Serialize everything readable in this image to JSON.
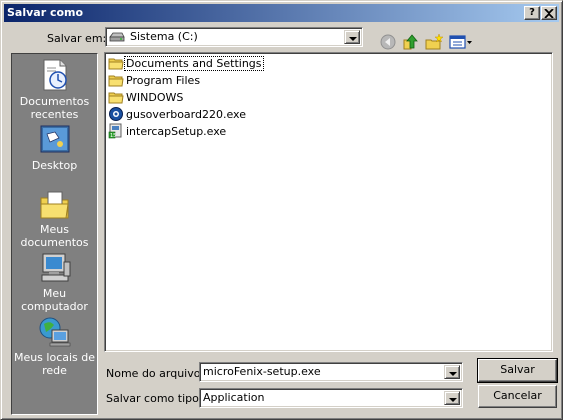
{
  "window": {
    "title": "Salvar como",
    "help_button": "?",
    "close_button": "✕"
  },
  "toolbar": {
    "save_in_label": "Salvar em:",
    "location": "Sistema (C:)",
    "buttons": [
      "back-icon",
      "up-folder-icon",
      "new-folder-icon",
      "views-menu-icon"
    ]
  },
  "places": [
    {
      "label": "Documentos recentes",
      "icon": "recent-documents-icon"
    },
    {
      "label": "Desktop",
      "icon": "desktop-icon"
    },
    {
      "label": "Meus documentos",
      "icon": "my-documents-icon"
    },
    {
      "label": "Meu computador",
      "icon": "my-computer-icon"
    },
    {
      "label": "Meus locais de rede",
      "icon": "network-places-icon"
    }
  ],
  "files": [
    {
      "name": "Documents and Settings",
      "type": "folder"
    },
    {
      "name": "Program Files",
      "type": "folder"
    },
    {
      "name": "WINDOWS",
      "type": "folder"
    },
    {
      "name": "gusoverboard220.exe",
      "type": "exe"
    },
    {
      "name": "intercapSetup.exe",
      "type": "exe"
    }
  ],
  "form": {
    "filename_label": "Nome do arquivo:",
    "filename_value": "microFenix-setup.exe",
    "filetype_label": "Salvar como tipo:",
    "filetype_value": "Application"
  },
  "actions": {
    "save_label": "Salvar",
    "cancel_label": "Cancelar"
  },
  "colors": {
    "title_start": "#0a246a",
    "title_end": "#a6caf0",
    "face": "#d4d0c8",
    "places_bg": "#808080"
  }
}
